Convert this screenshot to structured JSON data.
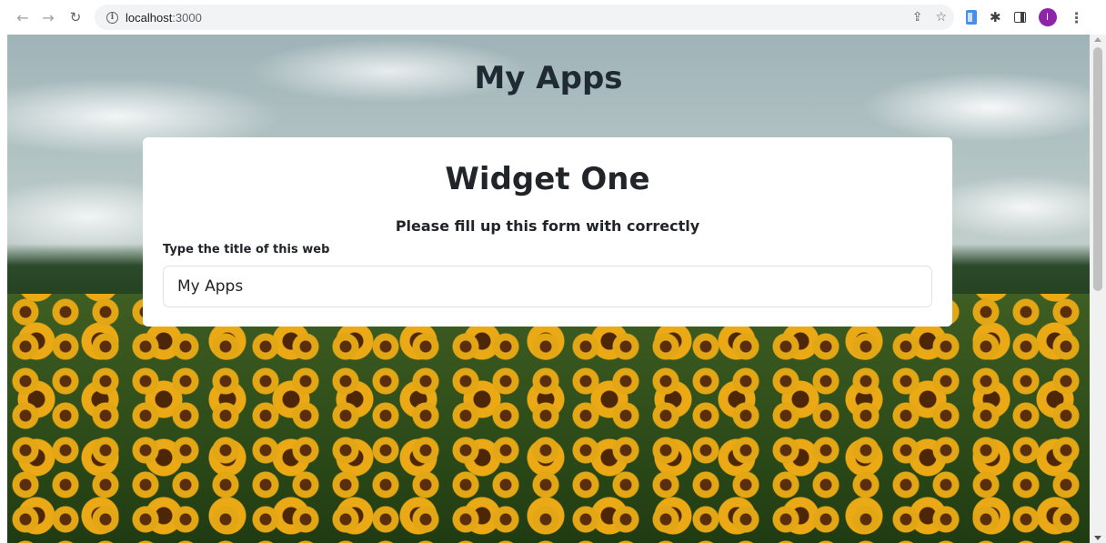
{
  "browser": {
    "url_host": "localhost",
    "url_port": ":3000",
    "avatar_initial": "I"
  },
  "page": {
    "title": "My Apps"
  },
  "widget": {
    "title": "Widget One",
    "subtitle": "Please fill up this form with correctly",
    "field_label": "Type the title of this web",
    "field_value": "My Apps"
  },
  "colors": {
    "avatar": "#8e24aa",
    "card_bg": "#ffffff",
    "text": "#212529"
  },
  "icons": [
    "back-arrow-icon",
    "forward-arrow-icon",
    "reload-icon",
    "info-icon",
    "share-icon",
    "bookmark-star-icon",
    "extension-doc-icon",
    "puzzle-icon",
    "side-panel-icon",
    "kebab-menu-icon"
  ]
}
